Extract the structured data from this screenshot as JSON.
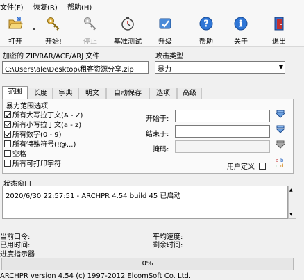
{
  "menu": {
    "file": "文件(F)",
    "restore": "恢复(R)",
    "help": "帮助(H)"
  },
  "toolbar": {
    "open": "打开",
    "start": "开始!",
    "stop": "停止",
    "benchmark": "基准测试",
    "upgrade": "升级",
    "help": "帮助",
    "about": "关于",
    "exit": "退出"
  },
  "file_group": {
    "label": "加密的 ZIP/RAR/ACE/ARJ 文件",
    "path": "C:\\Users\\ale\\Desktop\\租客资源分享.zip"
  },
  "attack_group": {
    "label": "攻击类型",
    "selected": "暴力"
  },
  "tabs": [
    "范围",
    "长度",
    "字典",
    "明文",
    "自动保存",
    "选项",
    "高级"
  ],
  "range": {
    "group_label": "暴力范围选项",
    "options": [
      {
        "label": "所有大写拉丁文(A - Z)",
        "checked": true
      },
      {
        "label": "所有小写拉丁文(a - z)",
        "checked": true
      },
      {
        "label": "所有数字(0 - 9)",
        "checked": true
      },
      {
        "label": "所有特殊符号(!@...)",
        "checked": false
      },
      {
        "label": "空格",
        "checked": false
      },
      {
        "label": "所有可打印字符",
        "checked": false
      }
    ],
    "start_label": "开始于:",
    "end_label": "结束于:",
    "mask_label": "掩码:",
    "user_defined_label": "用户定义"
  },
  "status": {
    "label": "状态窗口",
    "log": "2020/6/30 22:57:51 - ARCHPR 4.54 build 45 已启动"
  },
  "info": {
    "current_password": "当前口令:",
    "elapsed": "已用时间:",
    "progress_indicator": "进度指示器",
    "avg_speed": "平均速度:",
    "remaining": "剩余时间:"
  },
  "progress": {
    "value": 0,
    "text": "0%"
  },
  "footer": "ARCHPR version 4.54 (c) 1997-2012 ElcomSoft Co. Ltd."
}
